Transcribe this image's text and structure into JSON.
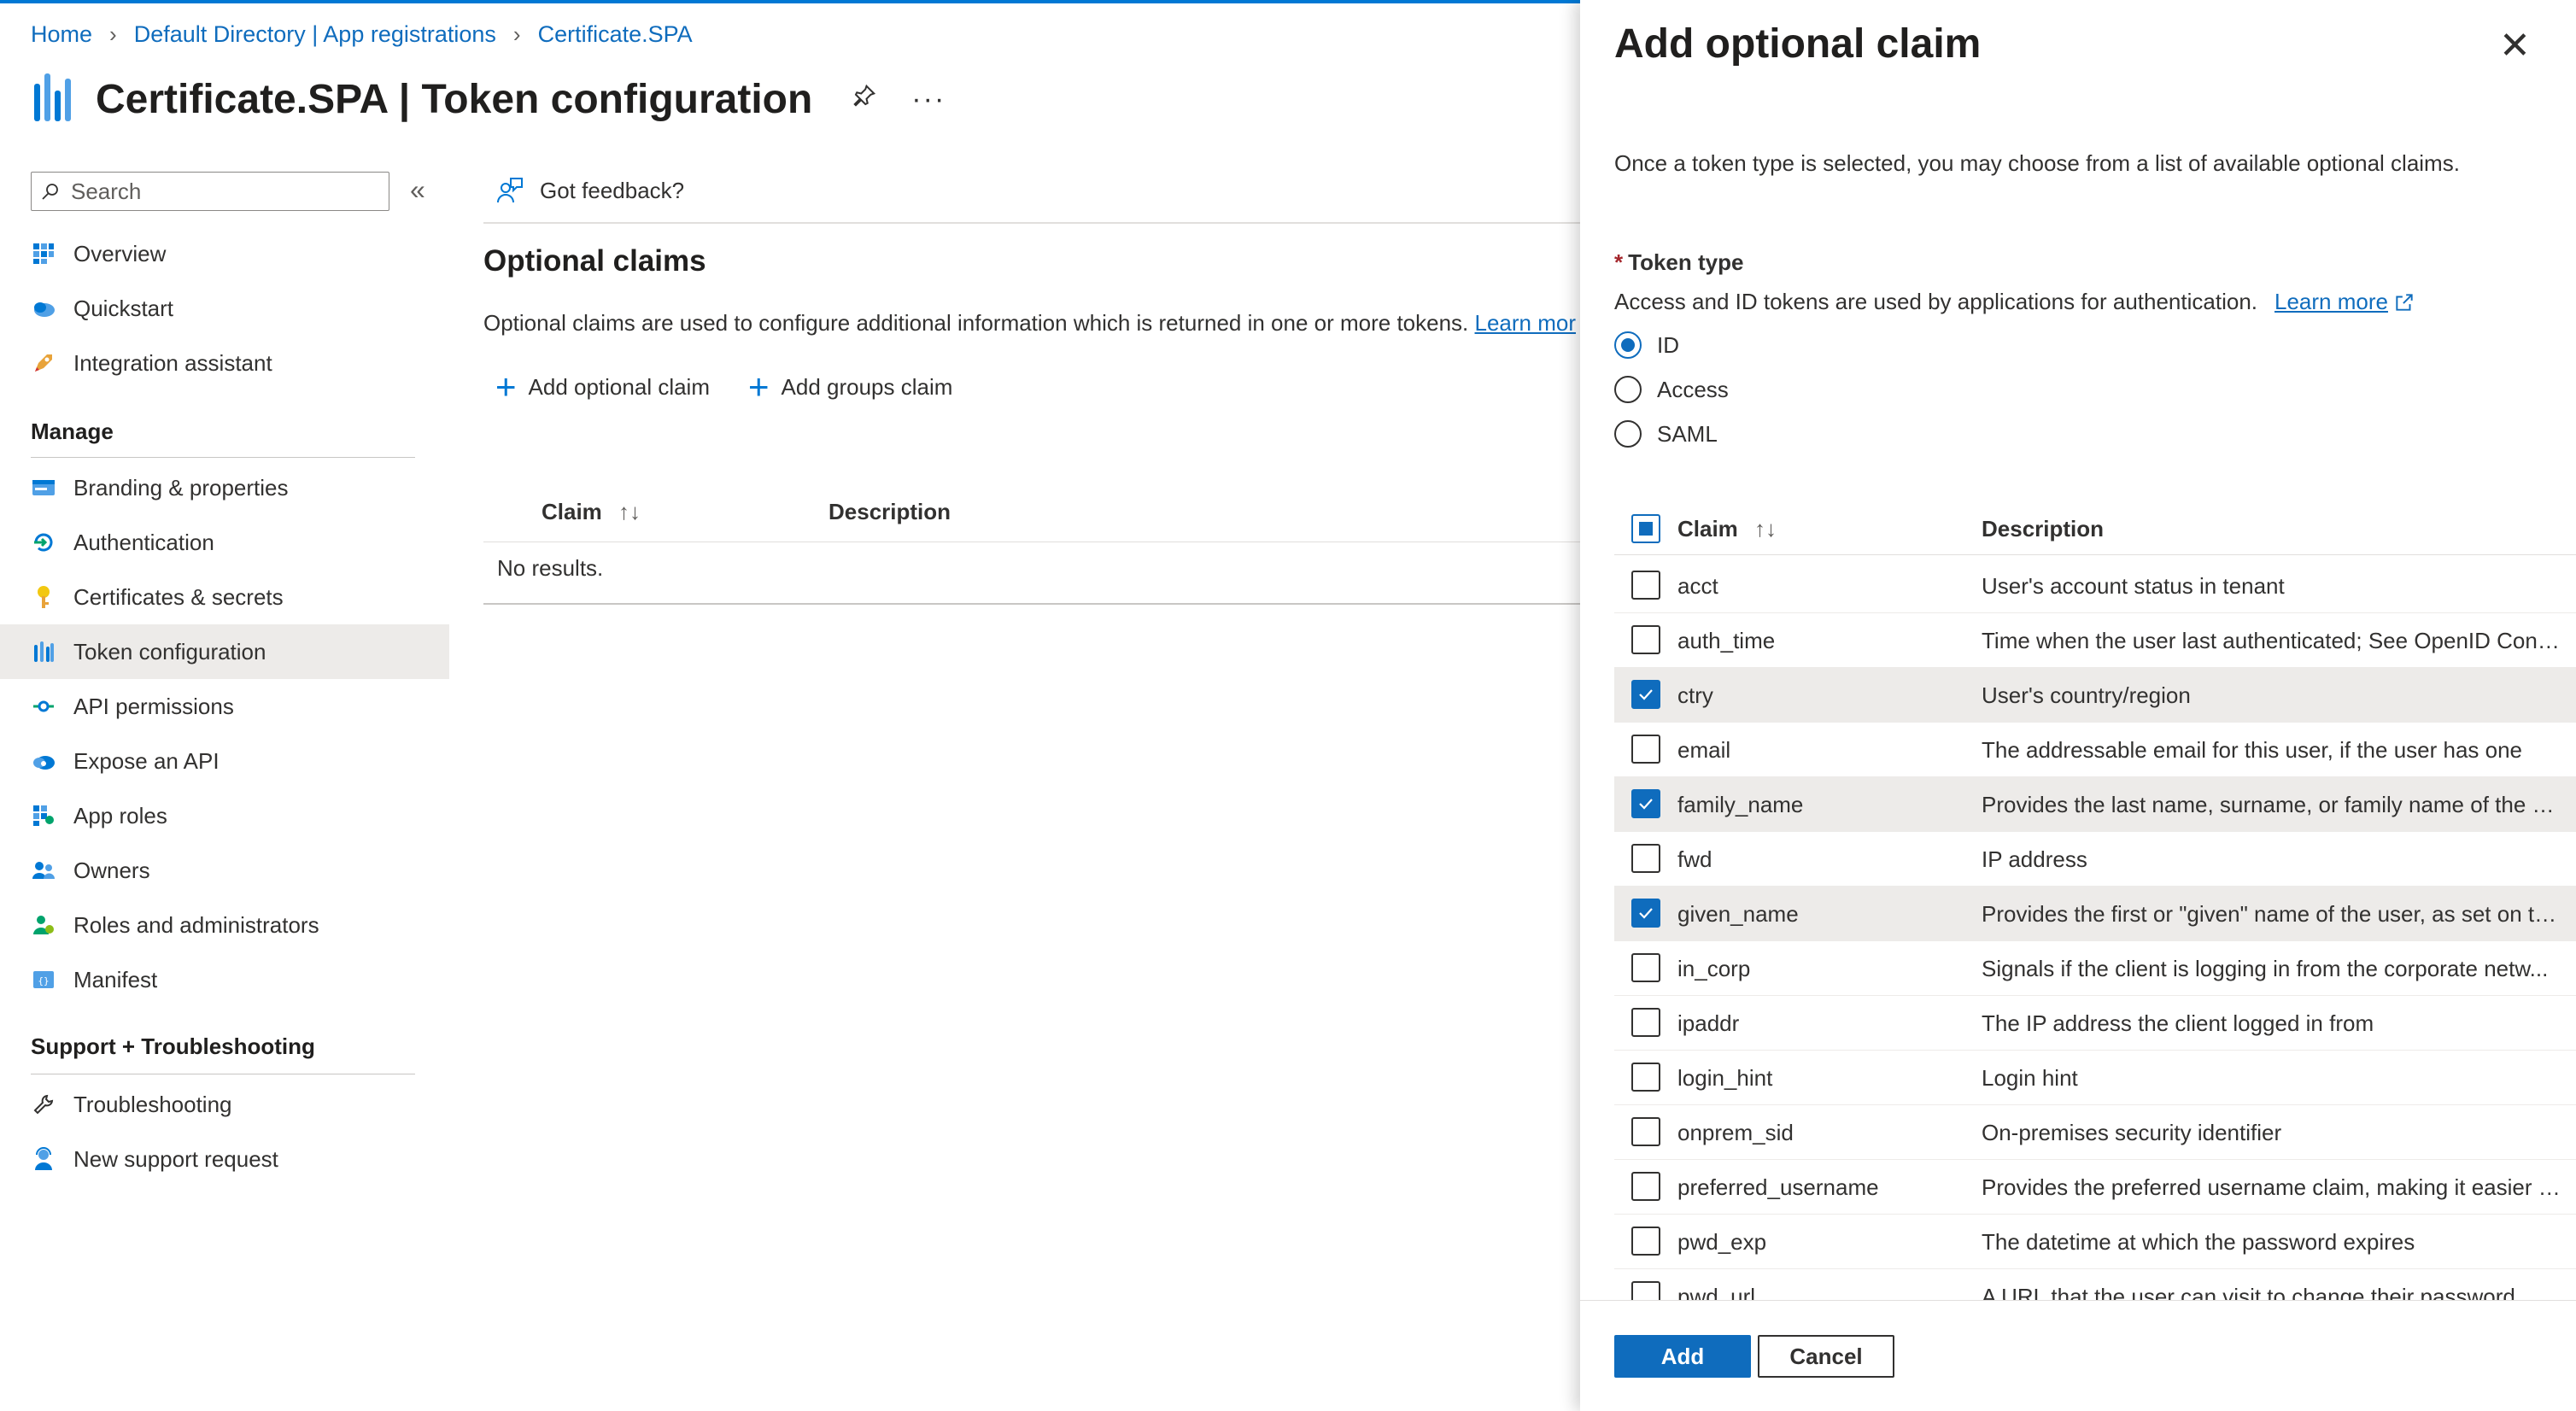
{
  "breadcrumb": {
    "home": "Home",
    "directory": "Default Directory | App registrations",
    "app": "Certificate.SPA"
  },
  "page": {
    "title": "Certificate.SPA | Token configuration",
    "more": "···"
  },
  "sidebar": {
    "search_placeholder": "Search",
    "collapse": "«",
    "items": [
      {
        "label": "Overview",
        "icon": "overview-icon"
      },
      {
        "label": "Quickstart",
        "icon": "quickstart-icon"
      },
      {
        "label": "Integration assistant",
        "icon": "rocket-icon"
      }
    ],
    "manage_heading": "Manage",
    "manage_items": [
      {
        "label": "Branding & properties",
        "icon": "branding-icon"
      },
      {
        "label": "Authentication",
        "icon": "authentication-icon"
      },
      {
        "label": "Certificates & secrets",
        "icon": "key-icon"
      },
      {
        "label": "Token configuration",
        "icon": "token-config-icon",
        "active": true
      },
      {
        "label": "API permissions",
        "icon": "api-permissions-icon"
      },
      {
        "label": "Expose an API",
        "icon": "cloud-icon"
      },
      {
        "label": "App roles",
        "icon": "app-roles-icon"
      },
      {
        "label": "Owners",
        "icon": "owners-icon"
      },
      {
        "label": "Roles and administrators",
        "icon": "roles-icon"
      },
      {
        "label": "Manifest",
        "icon": "manifest-icon"
      }
    ],
    "support_heading": "Support + Troubleshooting",
    "support_items": [
      {
        "label": "Troubleshooting",
        "icon": "wrench-icon"
      },
      {
        "label": "New support request",
        "icon": "support-person-icon"
      }
    ]
  },
  "main": {
    "feedback": "Got feedback?",
    "section_title": "Optional claims",
    "description": "Optional claims are used to configure additional information which is returned in one or more tokens.",
    "learn_more": "Learn mor",
    "add_optional_claim": "Add optional claim",
    "add_groups_claim": "Add groups claim",
    "columns": {
      "claim": "Claim",
      "sort": "↑↓",
      "description": "Description"
    },
    "empty": "No results."
  },
  "panel": {
    "title": "Add optional claim",
    "close": "✕",
    "intro": "Once a token type is selected, you may choose from a list of available optional claims.",
    "token_type_label": "Token type",
    "required_mark": "*",
    "token_type_desc": "Access and ID tokens are used by applications for authentication.",
    "learn_more": "Learn more",
    "token_types": [
      {
        "label": "ID",
        "selected": true
      },
      {
        "label": "Access",
        "selected": false
      },
      {
        "label": "SAML",
        "selected": false
      }
    ],
    "columns": {
      "claim": "Claim",
      "sort": "↑↓",
      "description": "Description"
    },
    "claims": [
      {
        "name": "acct",
        "description": "User's account status in tenant",
        "checked": false
      },
      {
        "name": "auth_time",
        "description": "Time when the user last authenticated; See OpenID Conn...",
        "checked": false
      },
      {
        "name": "ctry",
        "description": "User's country/region",
        "checked": true
      },
      {
        "name": "email",
        "description": "The addressable email for this user, if the user has one",
        "checked": false
      },
      {
        "name": "family_name",
        "description": "Provides the last name, surname, or family name of the us...",
        "checked": true
      },
      {
        "name": "fwd",
        "description": "IP address",
        "checked": false
      },
      {
        "name": "given_name",
        "description": "Provides the first or \"given\" name of the user, as set on th...",
        "checked": true
      },
      {
        "name": "in_corp",
        "description": "Signals if the client is logging in from the corporate netw...",
        "checked": false
      },
      {
        "name": "ipaddr",
        "description": "The IP address the client logged in from",
        "checked": false
      },
      {
        "name": "login_hint",
        "description": "Login hint",
        "checked": false
      },
      {
        "name": "onprem_sid",
        "description": "On-premises security identifier",
        "checked": false
      },
      {
        "name": "preferred_username",
        "description": "Provides the preferred username claim, making it easier f...",
        "checked": false
      },
      {
        "name": "pwd_exp",
        "description": "The datetime at which the password expires",
        "checked": false
      },
      {
        "name": "pwd_url",
        "description": "A URL that the user can visit to change their password",
        "checked": false
      }
    ],
    "add_button": "Add",
    "cancel_button": "Cancel"
  },
  "colors": {
    "accent": "#0f6cbd",
    "selected_row": "#edebe9",
    "required": "#a4262c"
  }
}
